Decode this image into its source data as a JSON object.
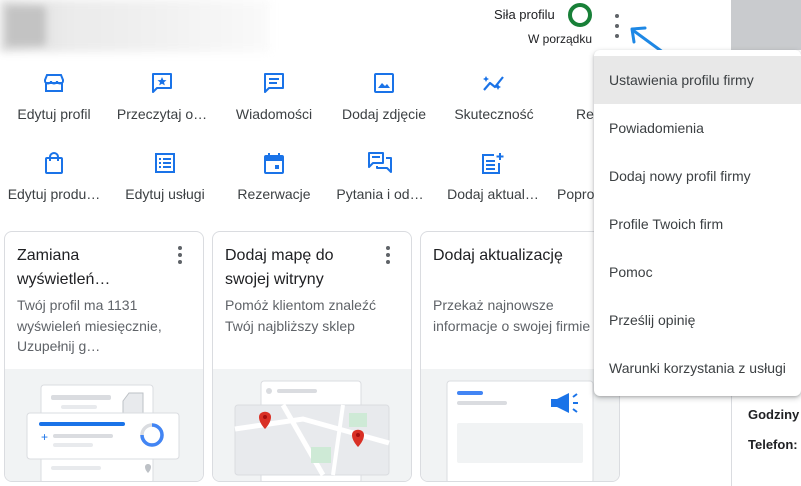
{
  "header": {
    "profile_strength_label": "Siła profilu",
    "profile_strength_status": "W porządku",
    "status_color": "#188038"
  },
  "actions_row1": [
    {
      "label": "Edytuj profil",
      "icon": "storefront-icon"
    },
    {
      "label": "Przeczytaj o…",
      "icon": "review-star-icon"
    },
    {
      "label": "Wiadomości",
      "icon": "message-icon"
    },
    {
      "label": "Dodaj zdjęcie",
      "icon": "photo-icon"
    },
    {
      "label": "Skuteczność",
      "icon": "performance-icon"
    },
    {
      "label": "Re",
      "icon": "ads-icon"
    }
  ],
  "actions_row2": [
    {
      "label": "Edytuj produ…",
      "icon": "shopping-bag-icon"
    },
    {
      "label": "Edytuj usługi",
      "icon": "services-list-icon"
    },
    {
      "label": "Rezerwacje",
      "icon": "calendar-icon"
    },
    {
      "label": "Pytania i od…",
      "icon": "qa-icon"
    },
    {
      "label": "Dodaj aktual…",
      "icon": "post-add-icon"
    },
    {
      "label": "Popro",
      "icon": "request-review-icon"
    }
  ],
  "cards": [
    {
      "title": "Zamiana wyświetleń…",
      "description": "Twój profil ma 1131 wyświeleń miesięcznie, Uzupełnij g…"
    },
    {
      "title": "Dodaj mapę do swojej witryny",
      "description": "Pomóż klientom znaleźć Twój najbliższy sklep"
    },
    {
      "title": "Dodaj aktualizację",
      "description": "Przekaż najnowsze informacje o swojej firmie"
    }
  ],
  "menu": {
    "items": [
      "Ustawienia profilu firmy",
      "Powiadomienia",
      "Dodaj nowy profil firmy",
      "Profile Twoich firm",
      "Pomoc",
      "Prześlij opinię",
      "Warunki korzystania z usługi"
    ],
    "highlighted_index": 0
  },
  "side_panel": {
    "hours_label": "Godziny",
    "phone_label": "Telefon:"
  },
  "colors": {
    "accent_blue": "#1a73e8",
    "arrow_blue": "#1e88e5",
    "map_pin_red": "#d93025"
  }
}
